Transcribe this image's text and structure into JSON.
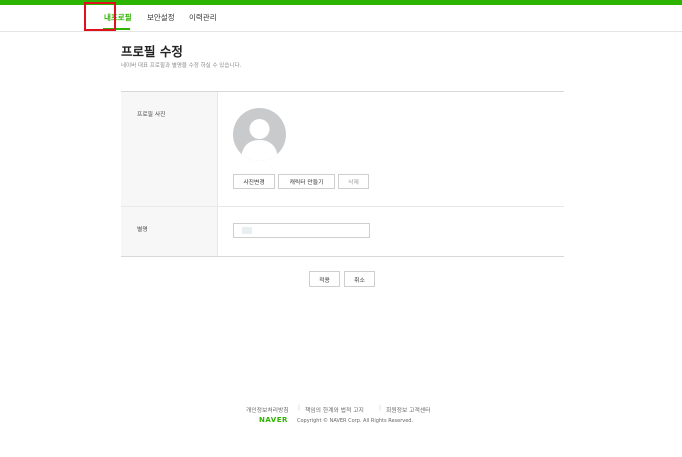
{
  "nav": {
    "tabs": [
      {
        "label": "내프로필",
        "active": true
      },
      {
        "label": "보안설정",
        "active": false
      },
      {
        "label": "이력관리",
        "active": false
      }
    ]
  },
  "colors": {
    "brand": "#2db400",
    "highlight": "#e1101e"
  },
  "main": {
    "title": "프로필 수정",
    "description": "네이버 대표 프로필과 별명을 수정 하실 수 있습니다."
  },
  "profile_photo": {
    "label": "프로필 사진",
    "avatar_icon": "default-user-icon",
    "buttons": {
      "change": "사진변경",
      "character": "캐릭터 만들기",
      "delete": "삭제"
    }
  },
  "nickname": {
    "label": "별명"
  },
  "actions": {
    "apply": "적용",
    "cancel": "취소"
  },
  "footer": {
    "links": [
      "개인정보처리방침",
      "책임의 한계와 법적 고지",
      "회원정보 고객센터"
    ],
    "brand": "NAVER",
    "copyright": "Copyright © NAVER Corp. All Rights Reserved."
  }
}
